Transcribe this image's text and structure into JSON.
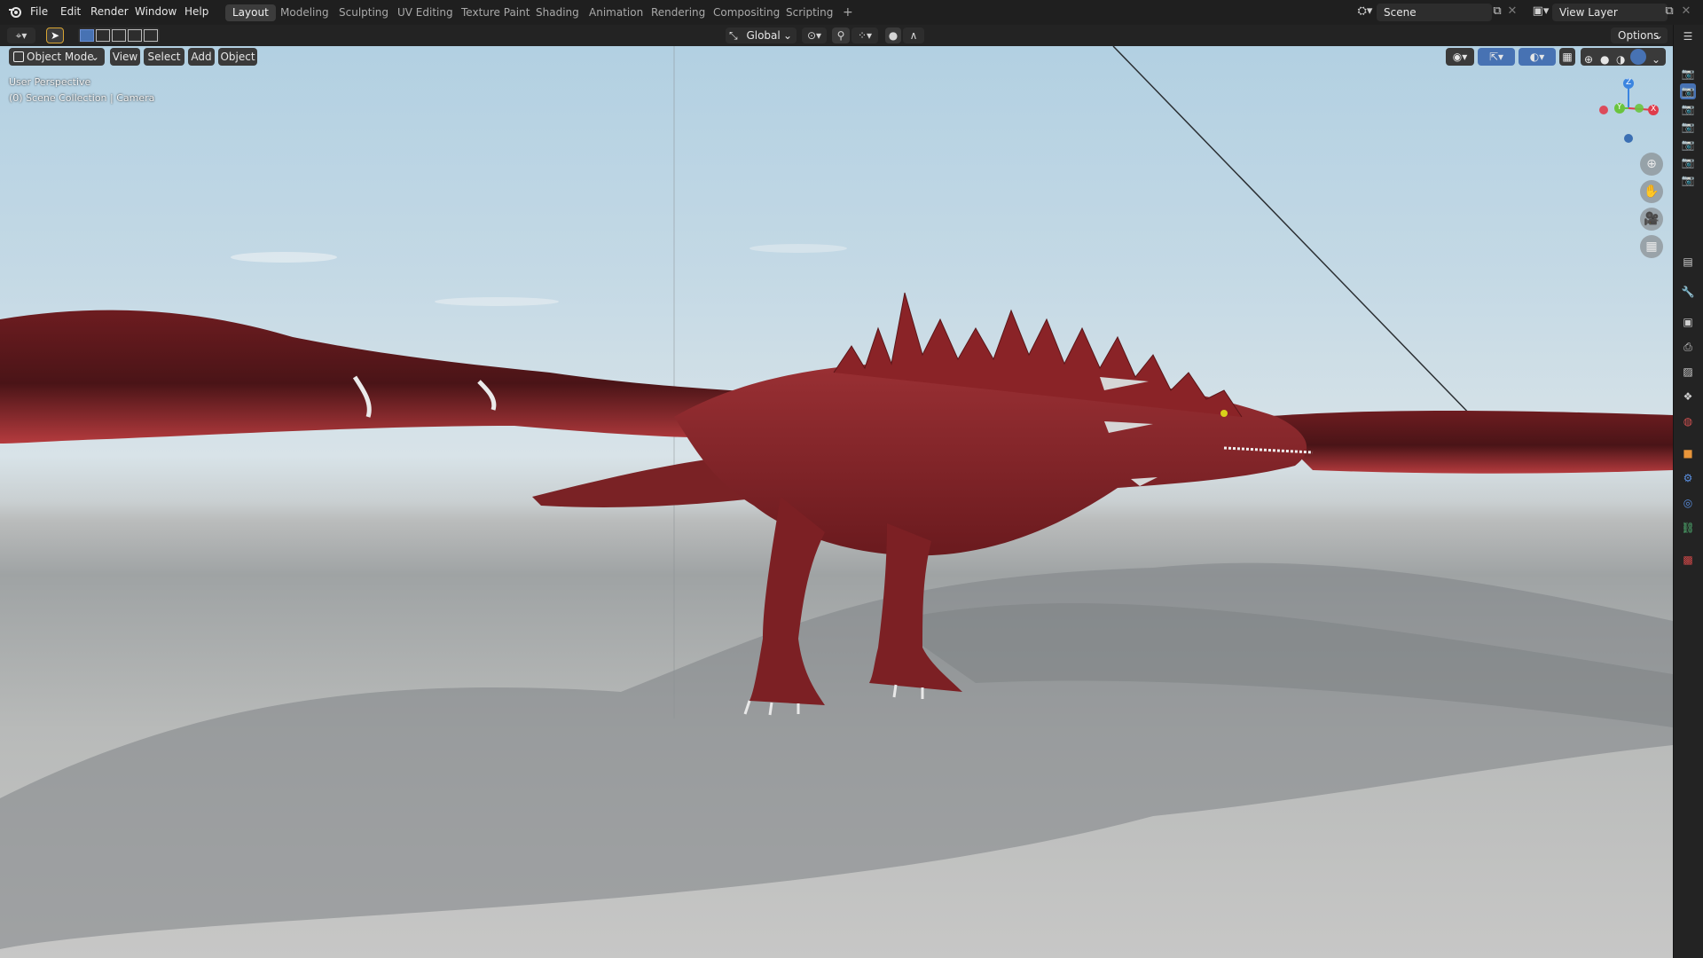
{
  "menus": [
    "File",
    "Edit",
    "Render",
    "Window",
    "Help"
  ],
  "workspaces": [
    "Layout",
    "Modeling",
    "Sculpting",
    "UV Editing",
    "Texture Paint",
    "Shading",
    "Animation",
    "Rendering",
    "Compositing",
    "Scripting"
  ],
  "active_workspace": "Layout",
  "add_workspace": "+",
  "scene": "Scene",
  "view_layer": "View Layer",
  "options_label": "Options",
  "transform_orientation": "Global",
  "viewport_header": {
    "mode": "Object Mode",
    "view": "View",
    "select": "Select",
    "add": "Add",
    "object": "Object"
  },
  "viewport_info": {
    "line1": "User Perspective",
    "line2": "(0) Scene Collection | Camera"
  },
  "gizmo": {
    "x": "X",
    "y": "Y",
    "z": "Z"
  },
  "colors": {
    "accent": "#4772b3",
    "x_axis": "#e03c4b",
    "y_axis": "#6ac43e",
    "z_axis": "#3b85e0",
    "dragon": "#9a2a2e"
  },
  "nav_icons": [
    "zoom-icon",
    "pan-hand-icon",
    "camera-view-icon",
    "ortho-grid-icon"
  ],
  "properties_icons": [
    "tool-icon",
    "render-icon",
    "output-icon",
    "view-layer-icon",
    "scene-icon",
    "world-icon",
    "object-icon",
    "modifier-icon",
    "physics-icon",
    "constraints-icon",
    "texture-icon"
  ]
}
